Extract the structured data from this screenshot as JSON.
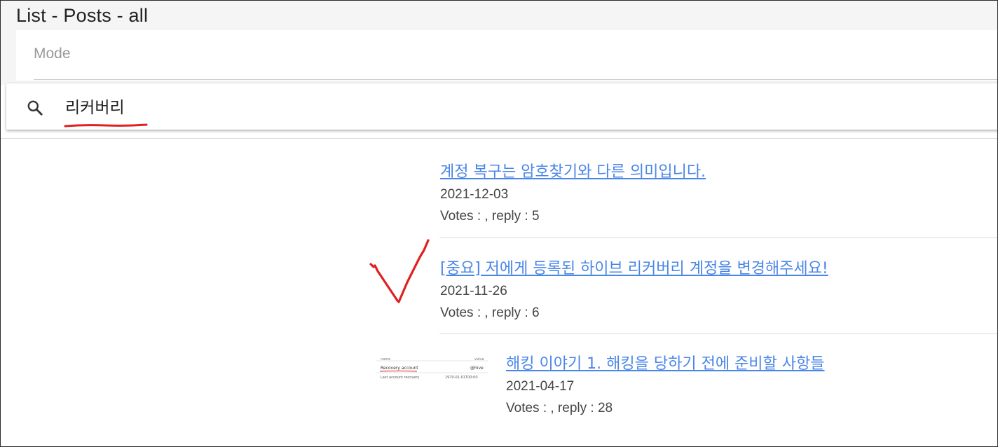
{
  "page": {
    "title": "List - Posts - all"
  },
  "mode": {
    "label": "Mode"
  },
  "search": {
    "value": "리커버리",
    "icon": "search-icon",
    "annotation_color": "#e02020"
  },
  "posts": [
    {
      "title": "계정 복구는 암호찾기와 다른 의미입니다.",
      "date": "2021-12-03",
      "meta": "Votes : , reply : 5"
    },
    {
      "title": "[중요] 저에게 등록된 하이브 리커버리 계정을 변경해주세요!",
      "date": "2021-11-26",
      "meta": "Votes : , reply : 6",
      "annotation": "check-mark"
    },
    {
      "title": "해킹 이야기 1. 해킹을 당하기 전에 준비할 사항들",
      "date": "2021-04-17",
      "meta": "Votes : , reply : 28",
      "thumbnail": {
        "row1_left": "name",
        "row1_right": "value",
        "row2_left": "Recovery account",
        "row2_right": "@hive",
        "row3_left": "Last account recovery",
        "row3_right": "1970-01-01T00:00"
      }
    }
  ],
  "colors": {
    "link": "#4a86e8",
    "annotation": "#e02020"
  }
}
